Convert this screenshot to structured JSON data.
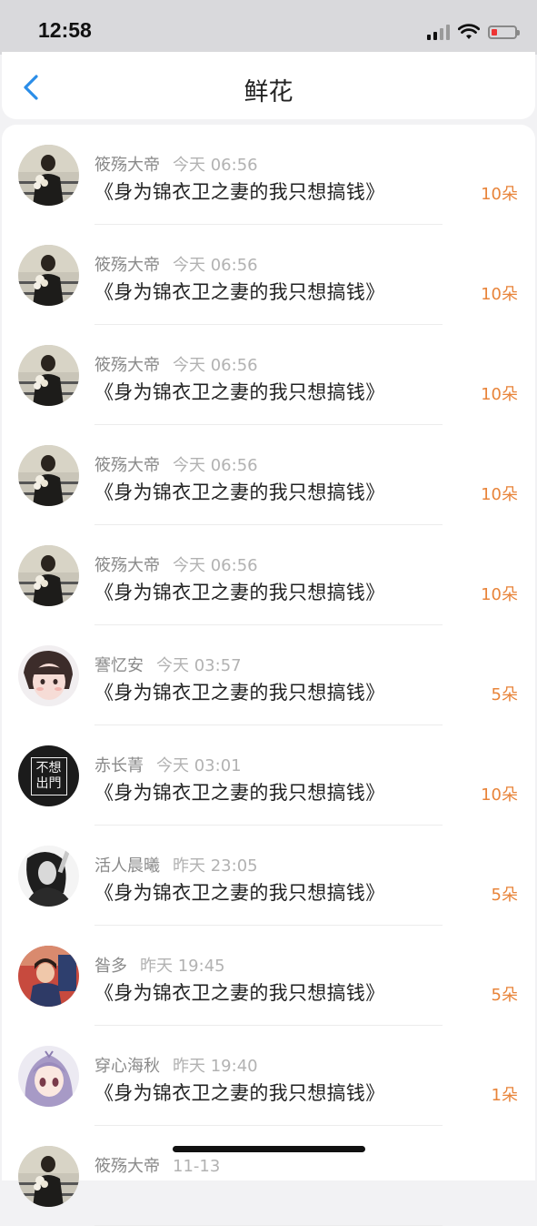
{
  "status_bar": {
    "time": "12:58",
    "battery_level": 0.15
  },
  "header": {
    "title": "鲜花",
    "back_icon": "chevron-left-icon"
  },
  "colors": {
    "accent": "#2a8de8",
    "count": "#e8843a"
  },
  "items": [
    {
      "name": "筱殇大帝",
      "time": "今天 06:56",
      "book": "《身为锦衣卫之妻的我只想搞钱》",
      "count": "10朵",
      "avatar": "man-with-flowers"
    },
    {
      "name": "筱殇大帝",
      "time": "今天 06:56",
      "book": "《身为锦衣卫之妻的我只想搞钱》",
      "count": "10朵",
      "avatar": "man-with-flowers"
    },
    {
      "name": "筱殇大帝",
      "time": "今天 06:56",
      "book": "《身为锦衣卫之妻的我只想搞钱》",
      "count": "10朵",
      "avatar": "man-with-flowers"
    },
    {
      "name": "筱殇大帝",
      "time": "今天 06:56",
      "book": "《身为锦衣卫之妻的我只想搞钱》",
      "count": "10朵",
      "avatar": "man-with-flowers"
    },
    {
      "name": "筱殇大帝",
      "time": "今天 06:56",
      "book": "《身为锦衣卫之妻的我只想搞钱》",
      "count": "10朵",
      "avatar": "man-with-flowers"
    },
    {
      "name": "謇忆安",
      "time": "今天 03:57",
      "book": "《身为锦衣卫之妻的我只想搞钱》",
      "count": "5朵",
      "avatar": "girl-face"
    },
    {
      "name": "赤长菁",
      "time": "今天 03:01",
      "book": "《身为锦衣卫之妻的我只想搞钱》",
      "count": "10朵",
      "avatar": "text-avatar",
      "avatar_text": [
        "不想",
        "出門"
      ]
    },
    {
      "name": "活人晨曦",
      "time": "昨天 23:05",
      "book": "《身为锦衣卫之妻的我只想搞钱》",
      "count": "5朵",
      "avatar": "bw-girl"
    },
    {
      "name": "昝多",
      "time": "昨天 19:45",
      "book": "《身为锦衣卫之妻的我只想搞钱》",
      "count": "5朵",
      "avatar": "girl-red-bg"
    },
    {
      "name": "穿心海秋",
      "time": "昨天 19:40",
      "book": "《身为锦衣卫之妻的我只想搞钱》",
      "count": "1朵",
      "avatar": "anime-girl"
    },
    {
      "name": "筱殇大帝",
      "time": "11-13",
      "book": "",
      "count": "",
      "avatar": "man-with-flowers"
    }
  ]
}
